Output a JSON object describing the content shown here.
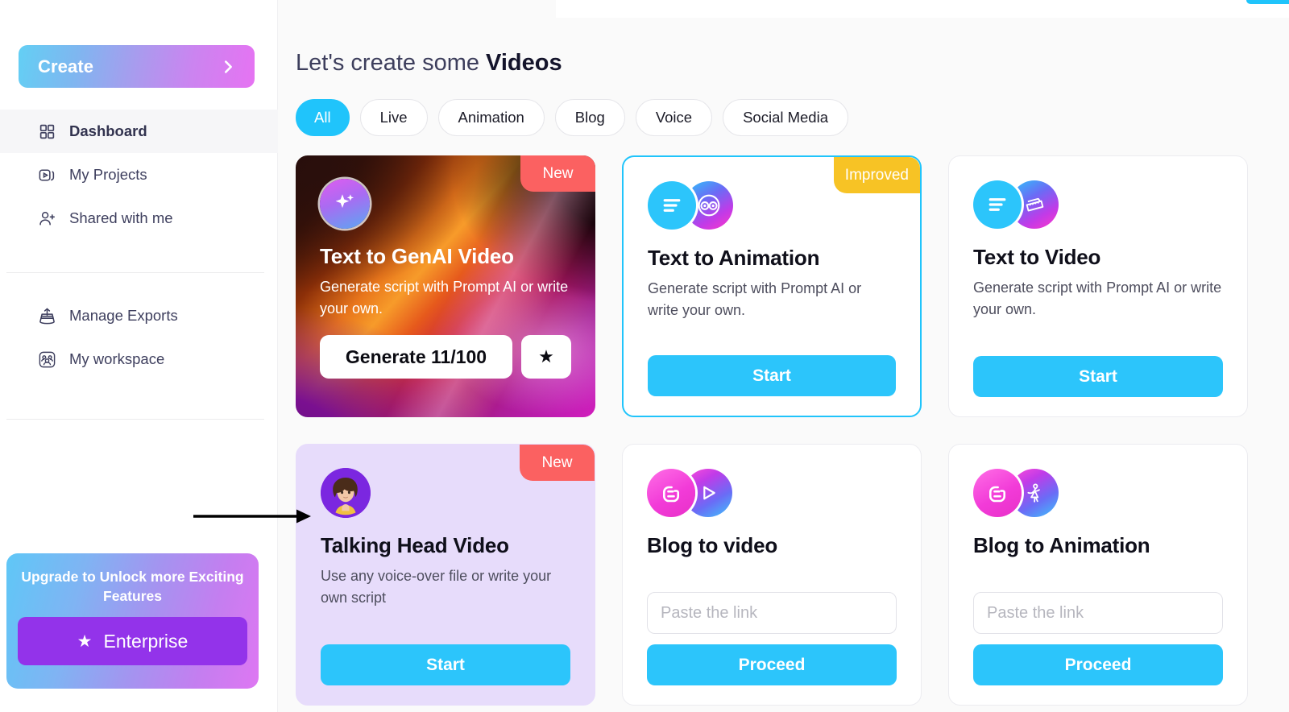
{
  "sidebar": {
    "create_button": {
      "label": "Create",
      "icon": "chevron-right-icon"
    },
    "items": [
      {
        "label": "Dashboard",
        "icon": "grid-icon",
        "active": true
      },
      {
        "label": "My Projects",
        "icon": "video-stack-icon",
        "active": false
      },
      {
        "label": "Shared with me",
        "icon": "user-plus-icon",
        "active": false
      },
      {
        "label": "Manage Exports",
        "icon": "export-icon",
        "active": false
      },
      {
        "label": "My workspace",
        "icon": "workspace-people-icon",
        "active": false
      }
    ],
    "upgrade": {
      "title": "Upgrade to Unlock more Exciting Features",
      "button_label": "Enterprise",
      "button_icon": "star-icon"
    }
  },
  "main": {
    "title_prefix": "Let's create some ",
    "title_strong": "Videos",
    "filters": [
      {
        "label": "All",
        "active": true
      },
      {
        "label": "Live",
        "active": false
      },
      {
        "label": "Animation",
        "active": false
      },
      {
        "label": "Blog",
        "active": false
      },
      {
        "label": "Voice",
        "active": false
      },
      {
        "label": "Social Media",
        "active": false
      }
    ],
    "cards": [
      {
        "title": "Text to GenAI Video",
        "desc": "Generate script with Prompt AI or write your own.",
        "badge": "New",
        "badge_kind": "new",
        "primary_label": "Generate 11/100",
        "secondary_icon": "star-icon",
        "style": "genai-gradient"
      },
      {
        "title": "Text to Animation",
        "desc": "Generate script with Prompt AI or write your own.",
        "badge": "Improved",
        "badge_kind": "improved",
        "primary_label": "Start",
        "style": "highlighted"
      },
      {
        "title": "Text to Video",
        "desc": "Generate script with Prompt AI or write your own.",
        "badge": "",
        "primary_label": "Start",
        "style": "plain"
      },
      {
        "title": "Talking Head Video",
        "desc": "Use any voice-over file or write your own script",
        "badge": "New",
        "badge_kind": "new",
        "primary_label": "Start",
        "style": "lavender"
      },
      {
        "title": "Blog to video",
        "input_placeholder": "Paste the link",
        "input_value": "",
        "primary_label": "Proceed",
        "style": "plain"
      },
      {
        "title": "Blog to Animation",
        "input_placeholder": "Paste the link",
        "input_value": "",
        "primary_label": "Proceed",
        "style": "plain"
      }
    ]
  },
  "colors": {
    "accent_cyan": "#20C4FB",
    "badge_new": "#FB6161",
    "badge_improved": "#F7C325",
    "enterprise_purple": "#9333EA",
    "lavender_card": "#E7DCFB"
  }
}
